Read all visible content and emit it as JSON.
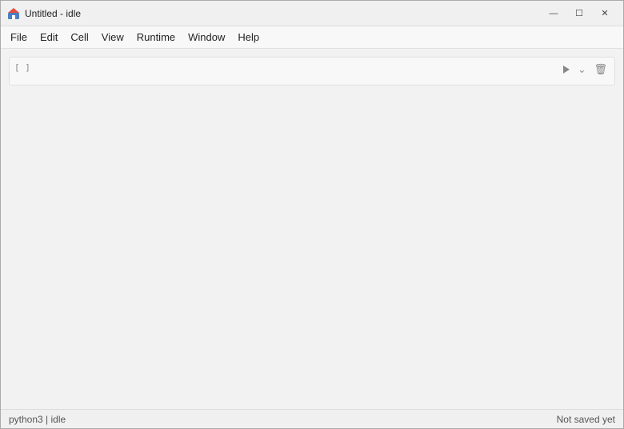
{
  "titlebar": {
    "title": "Untitled - idle",
    "icon": "🏠",
    "controls": {
      "minimize": "—",
      "maximize": "☐",
      "close": "✕"
    }
  },
  "menubar": {
    "items": [
      "File",
      "Edit",
      "Cell",
      "View",
      "Runtime",
      "Window",
      "Help"
    ]
  },
  "notebook": {
    "cell": {
      "label": "[ ]",
      "placeholder": "",
      "run_title": "Run cell",
      "expand_title": "More cell actions",
      "delete_title": "Delete cell"
    }
  },
  "statusbar": {
    "left": "python3 | idle",
    "right": "Not saved yet"
  }
}
